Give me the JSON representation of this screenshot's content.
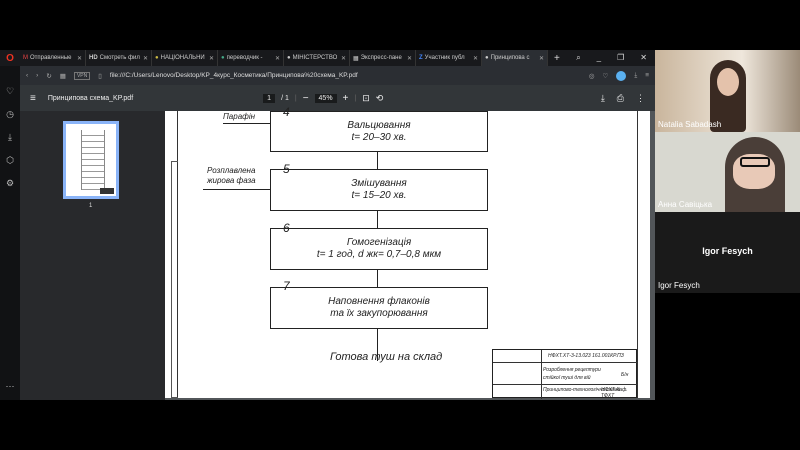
{
  "tabs": [
    {
      "label": "Отправленные",
      "icon": "gmail-icon"
    },
    {
      "label": "Смотреть фил",
      "icon": "hd-icon"
    },
    {
      "label": "НАЦІОНАЛЬНИ",
      "icon": "site-icon"
    },
    {
      "label": "переводчик -",
      "icon": "google-icon"
    },
    {
      "label": "МІНІСТЕРСТВО",
      "icon": "globe-icon"
    },
    {
      "label": "Экспресс-пане",
      "icon": "grid-icon"
    },
    {
      "label": "Участник публ",
      "icon": "zoom-icon"
    },
    {
      "label": "Принципова с",
      "icon": "globe-icon",
      "active": true
    }
  ],
  "address": {
    "vpn": "VPN",
    "url": "file:///C:/Users/Lenovo/Desktop/KP_4курс_Косметика/Принципова%20схема_KP.pdf"
  },
  "pdf": {
    "title": "Принципова схема_KP.pdf",
    "page_current": "1",
    "page_total": "/ 1",
    "zoom": "45%",
    "thumb_page": "1"
  },
  "diagram": {
    "side1": "Парафін",
    "step4": {
      "num": "4",
      "line1": "Вальцювання",
      "line2": "t= 20–30 хв."
    },
    "side2a": "Розплавлена",
    "side2b": "жирова фаза",
    "step5": {
      "num": "5",
      "line1": "Змішування",
      "line2": "t= 15–20 хв."
    },
    "step6": {
      "num": "6",
      "line1": "Гомогенізація",
      "line2": "t= 1 год, d жк= 0,7–0,8 мкм"
    },
    "step7": {
      "num": "7",
      "line1": "Наповнення флаконів",
      "line2": "та їх закупорювання"
    },
    "final": "Готова туш на склад",
    "stamp": {
      "code": "НФХТ.ХТ-3-13.023 161.001КР.ПЗ",
      "title1": "Розроблення рецептури",
      "title2": "стійкої туші для вій",
      "sheet": "Б/н",
      "scheme": "Принципово-технологічна схема",
      "org": "НФХТ Каф. ТФХТ"
    }
  },
  "participants": [
    {
      "name": "Natalia Sabadash"
    },
    {
      "name": "Анна Савіцька"
    },
    {
      "name": "Igor Fesych",
      "center": "Igor Fesych"
    }
  ]
}
